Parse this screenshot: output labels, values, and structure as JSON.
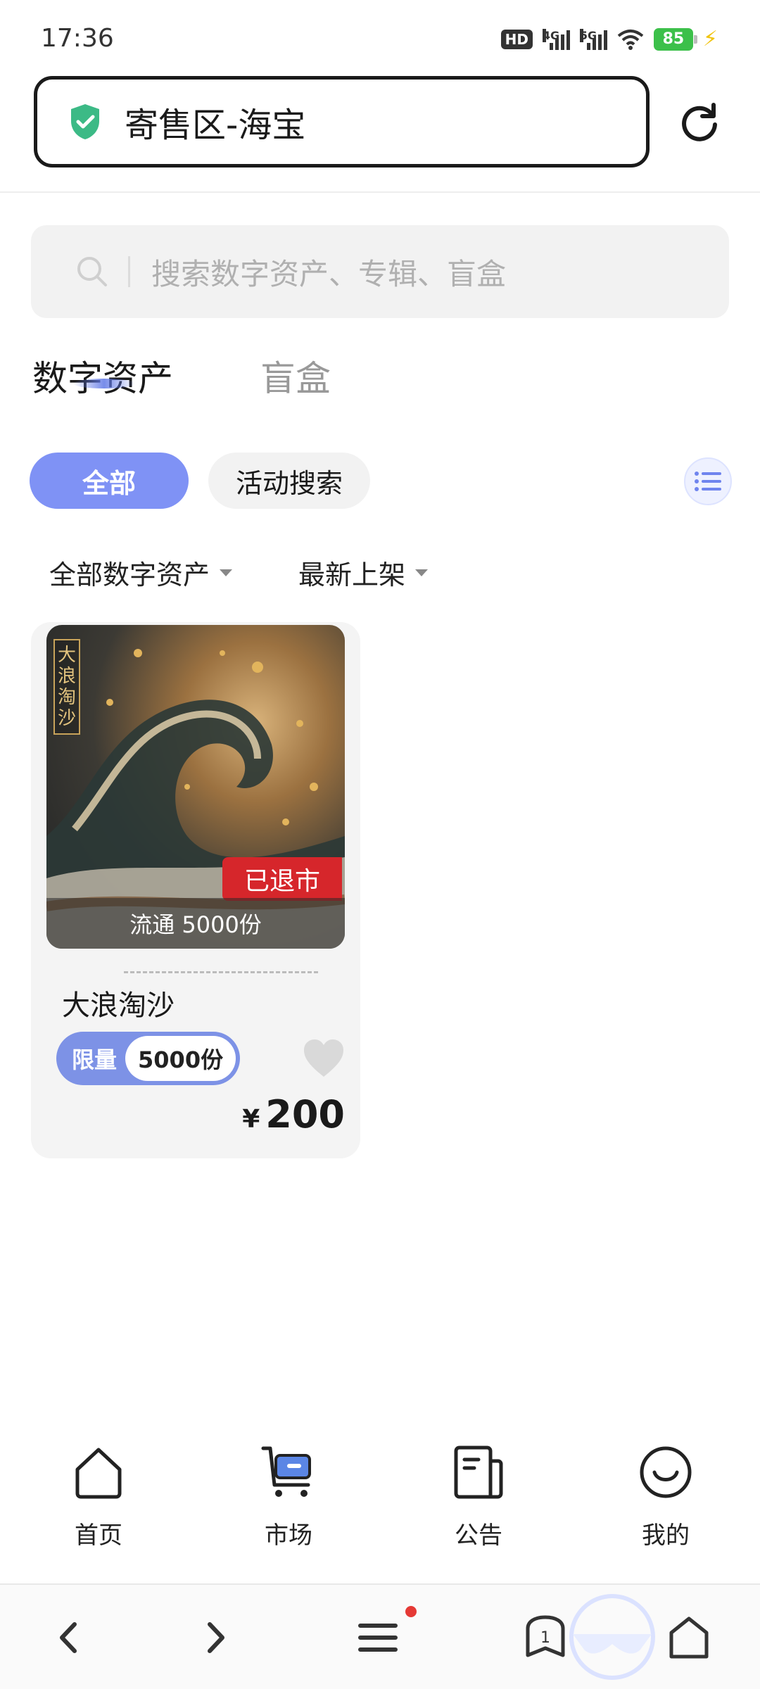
{
  "status_bar": {
    "time": "17:36",
    "hd_label": "HD",
    "net1": "4G",
    "net2": "5G",
    "battery": "85"
  },
  "browser": {
    "url_title": "寄售区-海宝"
  },
  "search": {
    "placeholder": "搜索数字资产、专辑、盲盒"
  },
  "tabs": [
    {
      "label": "数字资产",
      "active": true
    },
    {
      "label": "盲盒",
      "active": false
    }
  ],
  "filters": {
    "all": "全部",
    "activity": "活动搜索"
  },
  "sort": {
    "category": "全部数字资产",
    "order": "最新上架"
  },
  "product": {
    "art_title": "大浪淘沙",
    "status": "已退市",
    "circulation": "流通 5000份",
    "name": "大浪淘沙",
    "limit_label": "限量",
    "limit_count": "5000份",
    "price_symbol": "¥",
    "price": "200"
  },
  "nav": [
    {
      "label": "首页",
      "icon": "home-icon"
    },
    {
      "label": "市场",
      "icon": "cart-icon"
    },
    {
      "label": "公告",
      "icon": "notice-icon"
    },
    {
      "label": "我的",
      "icon": "profile-icon"
    }
  ],
  "colors": {
    "accent": "#7f92f5",
    "delisted": "#d6262b",
    "shield": "#3cba86"
  }
}
